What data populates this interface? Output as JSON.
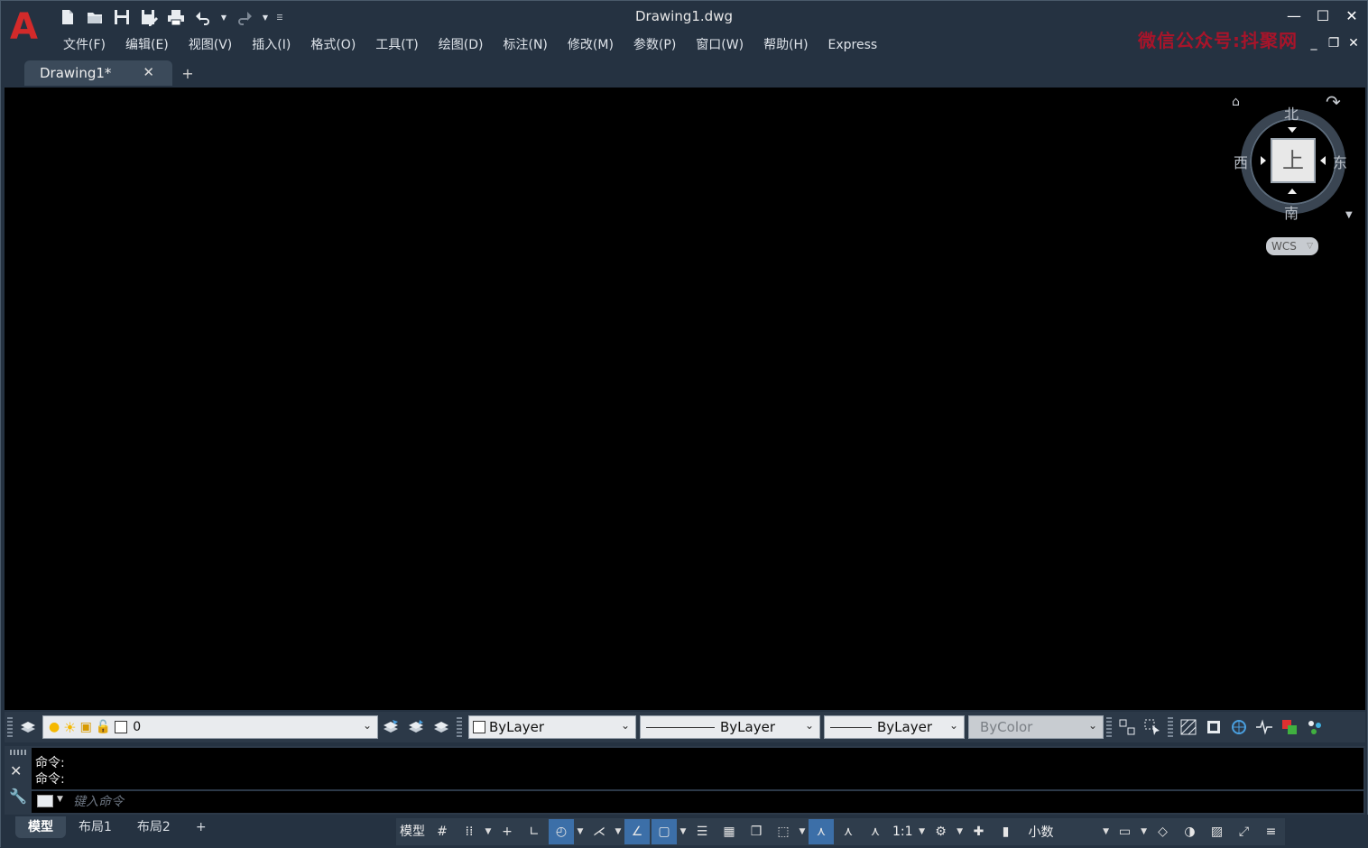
{
  "app": {
    "logo": "A",
    "doc_title": "Drawing1.dwg"
  },
  "watermark": "微信公众号:抖聚网",
  "qat": [
    "new-icon",
    "open-icon",
    "save-icon",
    "save-as-icon",
    "print-icon",
    "undo-icon",
    "redo-icon",
    "customize-icon"
  ],
  "menu": [
    "文件(F)",
    "编辑(E)",
    "视图(V)",
    "插入(I)",
    "格式(O)",
    "工具(T)",
    "绘图(D)",
    "标注(N)",
    "修改(M)",
    "参数(P)",
    "窗口(W)",
    "帮助(H)",
    "Express"
  ],
  "tabs": {
    "active": "Drawing1*",
    "close": "✕",
    "add": "+"
  },
  "viewcube": {
    "north": "北",
    "south": "南",
    "east": "东",
    "west": "西",
    "face": "上",
    "wcs": "WCS"
  },
  "propbar": {
    "layer_value": "0",
    "color": "ByLayer",
    "linetype": "ByLayer",
    "lineweight": "ByLayer",
    "plotstyle": "ByColor"
  },
  "command": {
    "history": [
      "命令:",
      "命令:"
    ],
    "placeholder": "键入命令"
  },
  "layout_tabs": [
    "模型",
    "布局1",
    "布局2"
  ],
  "layout_add": "+",
  "status": {
    "model": "模型",
    "scale": "1:1",
    "units": "小数"
  },
  "colors": {
    "accent": "#3c6fa8",
    "logo": "#d32a2a",
    "canvas": "#000000"
  }
}
